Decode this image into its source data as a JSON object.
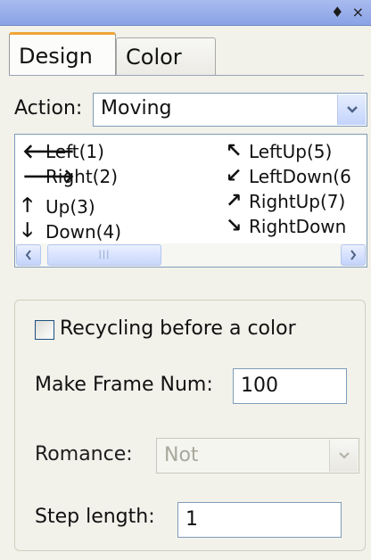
{
  "titlebar": {
    "controls_label": "♦ ×"
  },
  "tabs": [
    {
      "label": "Design"
    },
    {
      "label": "Color"
    }
  ],
  "action": {
    "label": "Action:",
    "value": "Moving"
  },
  "directions": [
    {
      "icon": "arrow-left-icon",
      "glyph": "🢐",
      "label": "Left(1)"
    },
    {
      "icon": "arrow-right-icon",
      "glyph": "🢒",
      "label": "Right(2)"
    },
    {
      "icon": "arrow-up-icon",
      "glyph": "🢑",
      "label": "Up(3)"
    },
    {
      "icon": "arrow-down-icon",
      "glyph": "🢓",
      "label": "Down(4)"
    },
    {
      "icon": "arrow-up-left-icon",
      "glyph": "↖",
      "label": "LeftUp(5)"
    },
    {
      "icon": "arrow-down-left-icon",
      "glyph": "↙",
      "label": "LeftDown(6"
    },
    {
      "icon": "arrow-up-right-icon",
      "glyph": "↗",
      "label": "RightUp(7)"
    },
    {
      "icon": "arrow-down-right-icon",
      "glyph": "↘",
      "label": "RightDown"
    }
  ],
  "options": {
    "recycling_label": "Recycling before a color",
    "frame_num_label": "Make Frame Num:",
    "frame_num_value": "100",
    "romance_label": "Romance:",
    "romance_value": "Not",
    "step_length_label": "Step length:",
    "step_length_value": "1"
  }
}
